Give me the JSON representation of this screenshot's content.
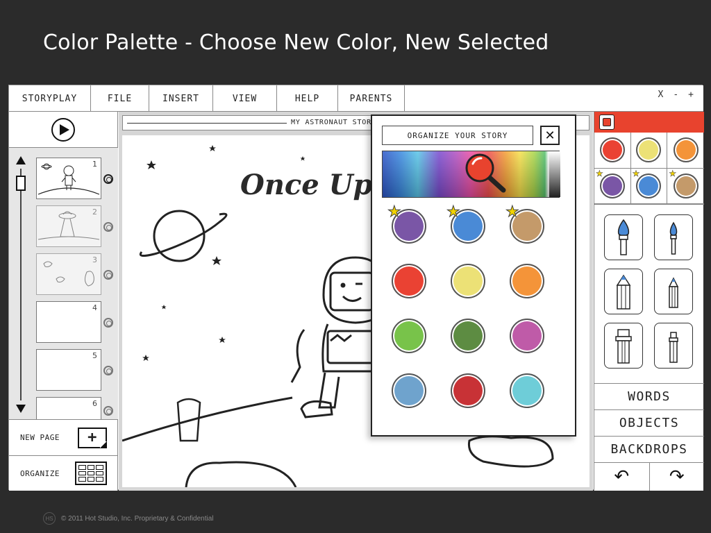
{
  "slide": {
    "title": "Color Palette - Choose New Color, New Selected",
    "footer": "© 2011 Hot Studio, Inc. Proprietary & Confidential"
  },
  "menu": {
    "items": [
      "STORYPLAY",
      "FILE",
      "INSERT",
      "VIEW",
      "HELP",
      "PARENTS"
    ],
    "window_controls": {
      "close": "X",
      "minimize": "-",
      "maximize": "+"
    }
  },
  "left_panel": {
    "pages": [
      {
        "num": "1",
        "selected": true
      },
      {
        "num": "2"
      },
      {
        "num": "3"
      },
      {
        "num": "4"
      },
      {
        "num": "5"
      },
      {
        "num": "6"
      }
    ],
    "new_page_label": "NEW PAGE",
    "organize_label": "ORGANIZE"
  },
  "canvas": {
    "story_name": "MY ASTRONAUT STORY",
    "title_text": "Once Upo"
  },
  "popup": {
    "title": "ORGANIZE YOUR STORY",
    "close_glyph": "✕",
    "swatches": [
      {
        "color": "#7a56a6",
        "star": true
      },
      {
        "color": "#4a8ad6",
        "star": true
      },
      {
        "color": "#c49a6a",
        "star": true
      },
      {
        "color": "#ea4233"
      },
      {
        "color": "#ece176"
      },
      {
        "color": "#f49439"
      },
      {
        "color": "#78c34a"
      },
      {
        "color": "#5d8c42"
      },
      {
        "color": "#bf5ba8"
      },
      {
        "color": "#6fa3cd"
      },
      {
        "color": "#c83236"
      },
      {
        "color": "#6ecdd8"
      }
    ]
  },
  "right_panel": {
    "selected_color": "#e8432e",
    "colors": [
      {
        "color": "#ea4233"
      },
      {
        "color": "#ece176"
      },
      {
        "color": "#f49439"
      },
      {
        "color": "#7a56a6",
        "star": true
      },
      {
        "color": "#4a8ad6",
        "star": true
      },
      {
        "color": "#c49a6a",
        "star": true
      }
    ],
    "tools": [
      "large-brush-icon",
      "small-brush-icon",
      "large-pencil-icon",
      "small-pencil-icon",
      "large-eraser-icon",
      "small-eraser-icon"
    ],
    "buttons": [
      "WORDS",
      "OBJECTS",
      "BACKDROPS"
    ],
    "undo_glyph": "↶",
    "redo_glyph": "↷"
  }
}
